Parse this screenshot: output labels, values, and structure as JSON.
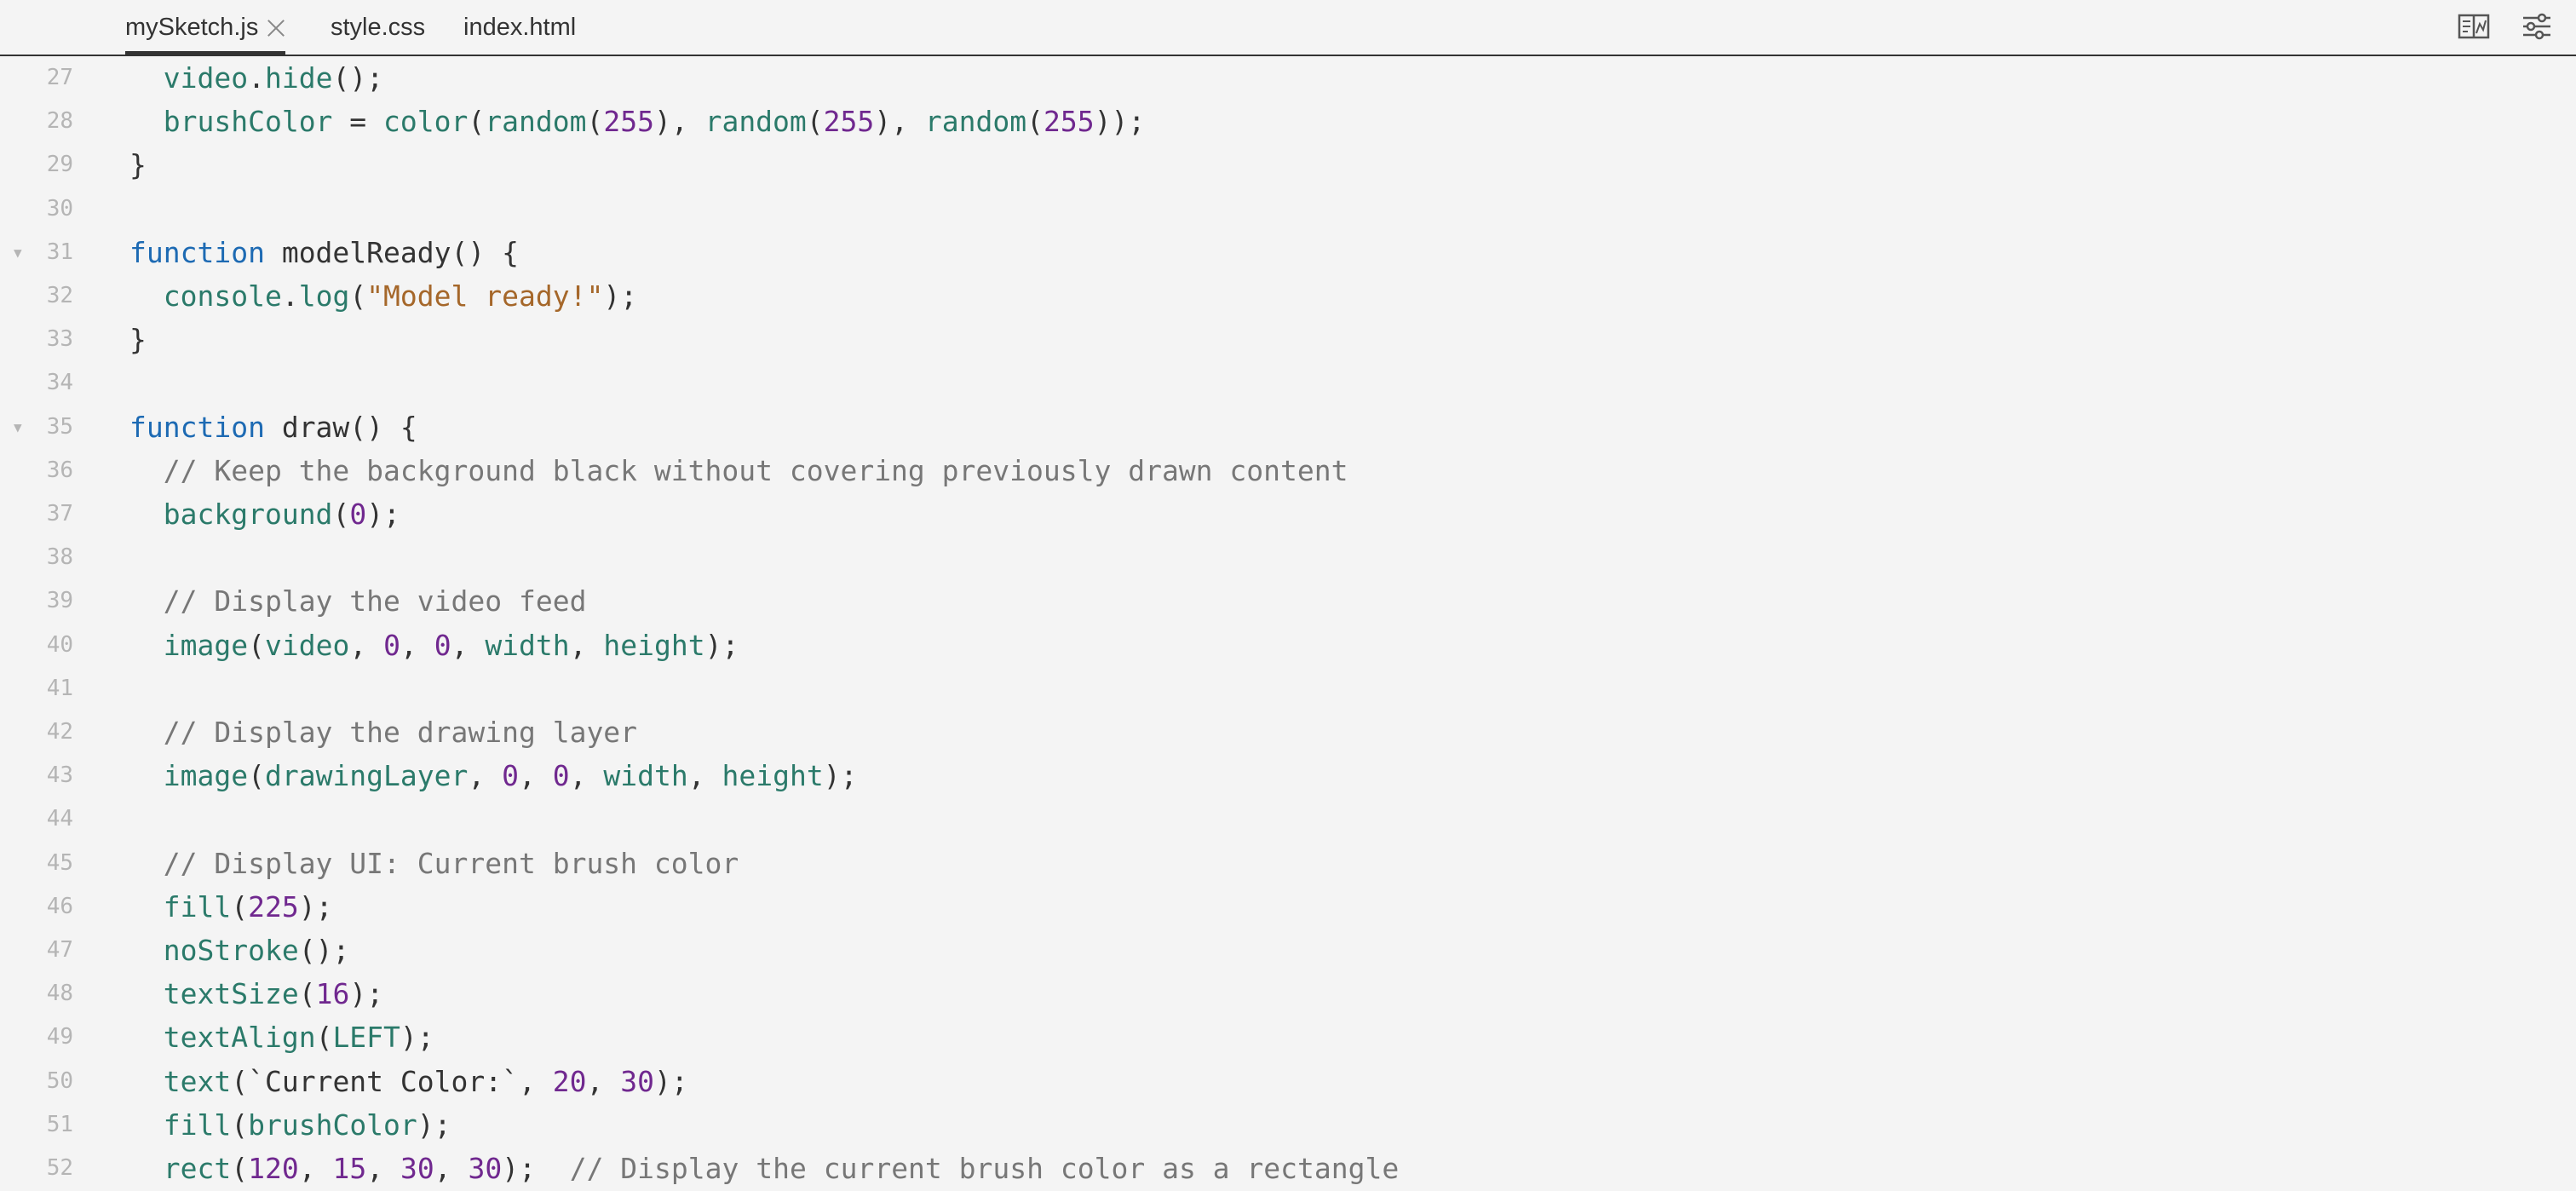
{
  "tabs": [
    {
      "label": "mySketch.js",
      "active": true,
      "closable": true
    },
    {
      "label": "style.css",
      "active": false,
      "closable": false
    },
    {
      "label": "index.html",
      "active": false,
      "closable": false
    }
  ],
  "toolbar": {
    "icons": [
      "layout-toggle-icon",
      "settings-sliders-icon"
    ]
  },
  "colors": {
    "keyword": "#1d6ab3",
    "function": "#2b7a6a",
    "number": "#70288f",
    "string": "#a5672a",
    "comment": "#777777",
    "plain": "#333333",
    "line_number": "#b5b5b5",
    "background": "#f4f4f4"
  },
  "editor": {
    "lines": [
      {
        "n": "27",
        "fold": false,
        "tokens": [
          [
            "pl",
            "  "
          ],
          [
            "fn",
            "video"
          ],
          [
            "pl",
            "."
          ],
          [
            "fn",
            "hide"
          ],
          [
            "pl",
            "();"
          ]
        ]
      },
      {
        "n": "28",
        "fold": false,
        "tokens": [
          [
            "pl",
            "  "
          ],
          [
            "fn",
            "brushColor"
          ],
          [
            "pl",
            " = "
          ],
          [
            "fn",
            "color"
          ],
          [
            "pl",
            "("
          ],
          [
            "fn",
            "random"
          ],
          [
            "pl",
            "("
          ],
          [
            "num",
            "255"
          ],
          [
            "pl",
            "), "
          ],
          [
            "fn",
            "random"
          ],
          [
            "pl",
            "("
          ],
          [
            "num",
            "255"
          ],
          [
            "pl",
            "), "
          ],
          [
            "fn",
            "random"
          ],
          [
            "pl",
            "("
          ],
          [
            "num",
            "255"
          ],
          [
            "pl",
            "));"
          ]
        ]
      },
      {
        "n": "29",
        "fold": false,
        "tokens": [
          [
            "pl",
            "}"
          ]
        ]
      },
      {
        "n": "30",
        "fold": false,
        "tokens": []
      },
      {
        "n": "31",
        "fold": true,
        "tokens": [
          [
            "kw",
            "function"
          ],
          [
            "pl",
            " modelReady() {"
          ]
        ]
      },
      {
        "n": "32",
        "fold": false,
        "tokens": [
          [
            "pl",
            "  "
          ],
          [
            "fn",
            "console"
          ],
          [
            "pl",
            "."
          ],
          [
            "fn",
            "log"
          ],
          [
            "pl",
            "("
          ],
          [
            "str",
            "\"Model ready!\""
          ],
          [
            "pl",
            ");"
          ]
        ]
      },
      {
        "n": "33",
        "fold": false,
        "tokens": [
          [
            "pl",
            "}"
          ]
        ]
      },
      {
        "n": "34",
        "fold": false,
        "tokens": []
      },
      {
        "n": "35",
        "fold": true,
        "tokens": [
          [
            "kw",
            "function"
          ],
          [
            "pl",
            " draw() {"
          ]
        ]
      },
      {
        "n": "36",
        "fold": false,
        "tokens": [
          [
            "pl",
            "  "
          ],
          [
            "cm",
            "// Keep the background black without covering previously drawn content"
          ]
        ]
      },
      {
        "n": "37",
        "fold": false,
        "tokens": [
          [
            "pl",
            "  "
          ],
          [
            "fn",
            "background"
          ],
          [
            "pl",
            "("
          ],
          [
            "num",
            "0"
          ],
          [
            "pl",
            ");"
          ]
        ]
      },
      {
        "n": "38",
        "fold": false,
        "tokens": []
      },
      {
        "n": "39",
        "fold": false,
        "tokens": [
          [
            "pl",
            "  "
          ],
          [
            "cm",
            "// Display the video feed"
          ]
        ]
      },
      {
        "n": "40",
        "fold": false,
        "tokens": [
          [
            "pl",
            "  "
          ],
          [
            "fn",
            "image"
          ],
          [
            "pl",
            "("
          ],
          [
            "fn",
            "video"
          ],
          [
            "pl",
            ", "
          ],
          [
            "num",
            "0"
          ],
          [
            "pl",
            ", "
          ],
          [
            "num",
            "0"
          ],
          [
            "pl",
            ", "
          ],
          [
            "fn",
            "width"
          ],
          [
            "pl",
            ", "
          ],
          [
            "fn",
            "height"
          ],
          [
            "pl",
            ");"
          ]
        ]
      },
      {
        "n": "41",
        "fold": false,
        "tokens": []
      },
      {
        "n": "42",
        "fold": false,
        "tokens": [
          [
            "pl",
            "  "
          ],
          [
            "cm",
            "// Display the drawing layer"
          ]
        ]
      },
      {
        "n": "43",
        "fold": false,
        "tokens": [
          [
            "pl",
            "  "
          ],
          [
            "fn",
            "image"
          ],
          [
            "pl",
            "("
          ],
          [
            "fn",
            "drawingLayer"
          ],
          [
            "pl",
            ", "
          ],
          [
            "num",
            "0"
          ],
          [
            "pl",
            ", "
          ],
          [
            "num",
            "0"
          ],
          [
            "pl",
            ", "
          ],
          [
            "fn",
            "width"
          ],
          [
            "pl",
            ", "
          ],
          [
            "fn",
            "height"
          ],
          [
            "pl",
            ");"
          ]
        ]
      },
      {
        "n": "44",
        "fold": false,
        "tokens": []
      },
      {
        "n": "45",
        "fold": false,
        "tokens": [
          [
            "pl",
            "  "
          ],
          [
            "cm",
            "// Display UI: Current brush color"
          ]
        ]
      },
      {
        "n": "46",
        "fold": false,
        "tokens": [
          [
            "pl",
            "  "
          ],
          [
            "fn",
            "fill"
          ],
          [
            "pl",
            "("
          ],
          [
            "num",
            "225"
          ],
          [
            "pl",
            ");"
          ]
        ]
      },
      {
        "n": "47",
        "fold": false,
        "tokens": [
          [
            "pl",
            "  "
          ],
          [
            "fn",
            "noStroke"
          ],
          [
            "pl",
            "();"
          ]
        ]
      },
      {
        "n": "48",
        "fold": false,
        "tokens": [
          [
            "pl",
            "  "
          ],
          [
            "fn",
            "textSize"
          ],
          [
            "pl",
            "("
          ],
          [
            "num",
            "16"
          ],
          [
            "pl",
            ");"
          ]
        ]
      },
      {
        "n": "49",
        "fold": false,
        "tokens": [
          [
            "pl",
            "  "
          ],
          [
            "fn",
            "textAlign"
          ],
          [
            "pl",
            "("
          ],
          [
            "fn",
            "LEFT"
          ],
          [
            "pl",
            ");"
          ]
        ]
      },
      {
        "n": "50",
        "fold": false,
        "tokens": [
          [
            "pl",
            "  "
          ],
          [
            "fn",
            "text"
          ],
          [
            "pl",
            "(`Current Color:`, "
          ],
          [
            "num",
            "20"
          ],
          [
            "pl",
            ", "
          ],
          [
            "num",
            "30"
          ],
          [
            "pl",
            ");"
          ]
        ]
      },
      {
        "n": "51",
        "fold": false,
        "tokens": [
          [
            "pl",
            "  "
          ],
          [
            "fn",
            "fill"
          ],
          [
            "pl",
            "("
          ],
          [
            "fn",
            "brushColor"
          ],
          [
            "pl",
            ");"
          ]
        ]
      },
      {
        "n": "52",
        "fold": false,
        "tokens": [
          [
            "pl",
            "  "
          ],
          [
            "fn",
            "rect"
          ],
          [
            "pl",
            "("
          ],
          [
            "num",
            "120"
          ],
          [
            "pl",
            ", "
          ],
          [
            "num",
            "15"
          ],
          [
            "pl",
            ", "
          ],
          [
            "num",
            "30"
          ],
          [
            "pl",
            ", "
          ],
          [
            "num",
            "30"
          ],
          [
            "pl",
            ");  "
          ],
          [
            "cm",
            "// Display the current brush color as a rectangle"
          ]
        ]
      }
    ]
  }
}
